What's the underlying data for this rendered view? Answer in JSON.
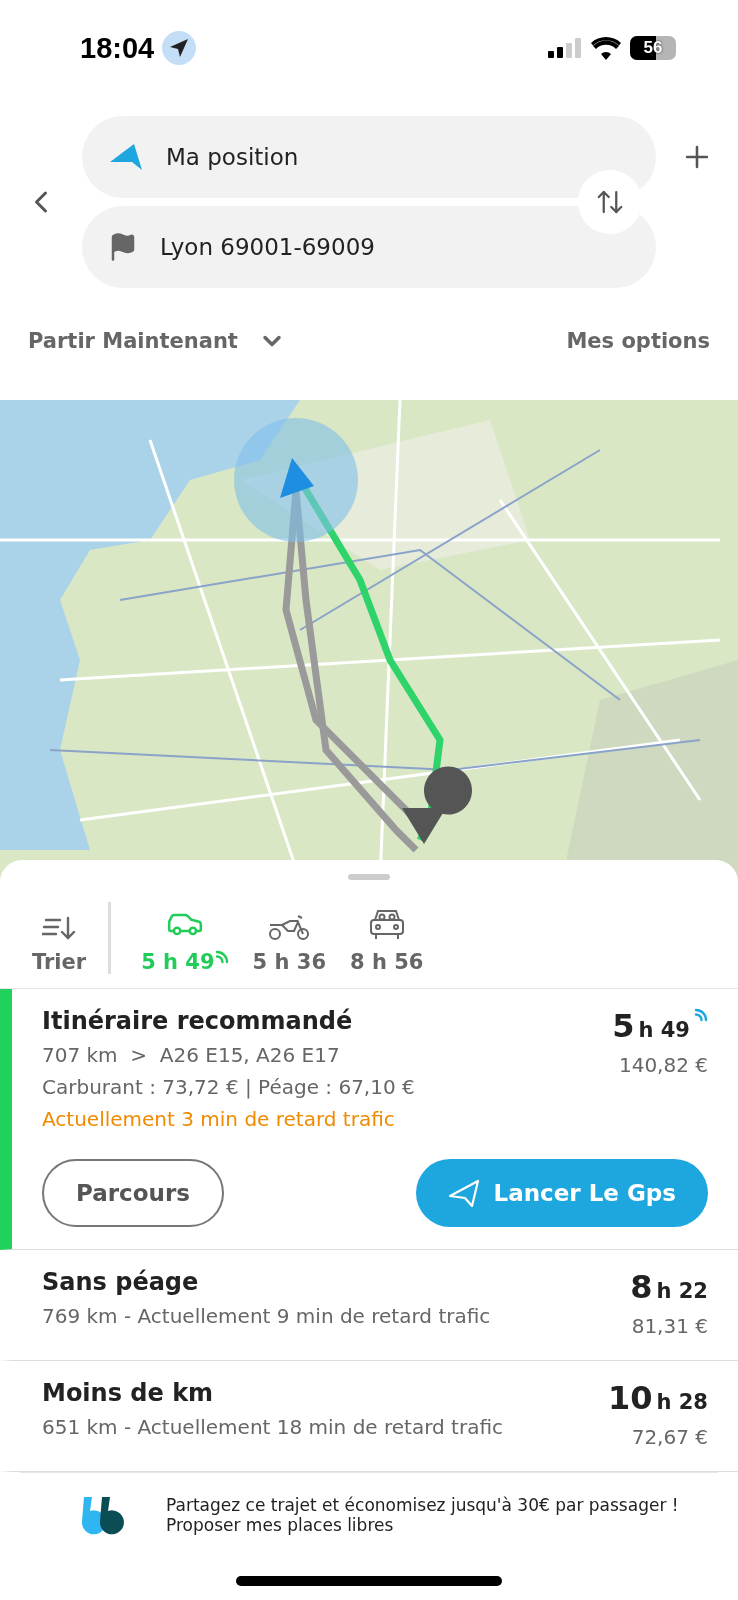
{
  "status_bar": {
    "time": "18:04",
    "battery": "56"
  },
  "route_inputs": [
    {
      "kind": "origin",
      "value": "Ma position"
    },
    {
      "kind": "destination",
      "value": "Lyon 69001-69009"
    }
  ],
  "departure": "Partir Maintenant",
  "options": "Mes options",
  "sort_label": "Trier",
  "modes": [
    {
      "kind": "car",
      "duration": "5 h 49",
      "selected": true,
      "live": true
    },
    {
      "kind": "motorbike",
      "duration": "5 h 36",
      "selected": false,
      "live": false
    },
    {
      "kind": "carpool",
      "duration": "8 h 56",
      "selected": false,
      "live": false
    }
  ],
  "routes": [
    {
      "title": "Itinéraire recommandé",
      "hours": "5",
      "minutes": "h 49",
      "live": true,
      "price": "140,82 €",
      "selected": true,
      "details": [
        "707 km  >  A26 E15, A26 E17",
        "Carburant : 73,72 € | Péage : 67,10 €"
      ],
      "delay": "Actuellement 3 min de retard trafic",
      "buttons": [
        {
          "kind": "outline",
          "label": "Parcours"
        },
        {
          "kind": "primary",
          "label": "Lancer Le Gps"
        }
      ]
    },
    {
      "title": "Sans péage",
      "hours": "8",
      "minutes": "h 22",
      "live": false,
      "price": "81,31 €",
      "selected": false,
      "details": [
        "769 km - Actuellement 9 min de retard trafic"
      ]
    },
    {
      "title": "Moins de km",
      "hours": "10",
      "minutes": "h 28",
      "live": false,
      "price": "72,67 €",
      "selected": false,
      "details": [
        "651 km - Actuellement 18 min de retard trafic"
      ]
    }
  ],
  "promo": {
    "text": "Partagez ce trajet et économisez jusqu'à 30€ par passager !",
    "link": "Proposer mes places libres"
  }
}
